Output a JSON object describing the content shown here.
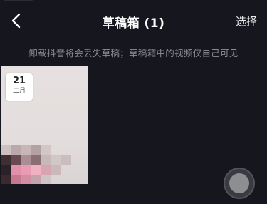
{
  "navbar": {
    "title": "草稿箱 (1)",
    "select_label": "选择"
  },
  "notice": "卸载抖音将会丢失草稿；草稿箱中的视频仅自己可见",
  "drafts": [
    {
      "day": "21",
      "month": "二月"
    }
  ],
  "colors": {
    "background": "#16161e",
    "notice_text": "#8d8d96"
  },
  "icons": {
    "back": "chevron-left-icon",
    "record": "record-button-icon"
  }
}
